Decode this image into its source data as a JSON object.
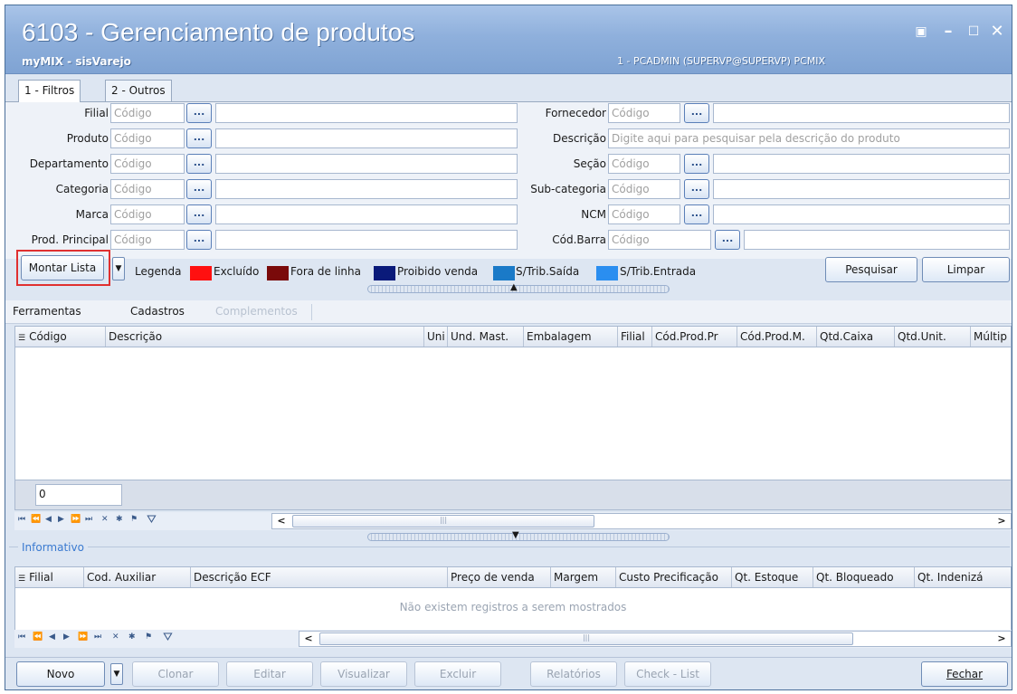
{
  "window": {
    "title": "6103 - Gerenciamento de produtos",
    "subtitle": "myMIX - sisVarejo",
    "user": "1 - PCADMIN (SUPERVP@SUPERVP)   PCMIX",
    "controls": {
      "restore": "▣",
      "minimize": "–",
      "maximize": "☐",
      "close": "✕"
    }
  },
  "tabs": [
    {
      "label": "1 - Filtros"
    },
    {
      "label": "2 - Outros"
    }
  ],
  "filters": {
    "left": [
      {
        "label": "Filial",
        "placeholder": "Código"
      },
      {
        "label": "Produto",
        "placeholder": "Código"
      },
      {
        "label": "Departamento",
        "placeholder": "Código"
      },
      {
        "label": "Categoria",
        "placeholder": "Código"
      },
      {
        "label": "Marca",
        "placeholder": "Código"
      },
      {
        "label": "Prod. Principal",
        "placeholder": "Código"
      }
    ],
    "right": [
      {
        "label": "Fornecedor",
        "placeholder": "Código"
      },
      {
        "label": "Descrição",
        "placeholder": "Digite aqui para pesquisar pela descrição do produto"
      },
      {
        "label": "Seção",
        "placeholder": "Código"
      },
      {
        "label": "Sub-categoria",
        "placeholder": "Código"
      },
      {
        "label": "NCM",
        "placeholder": "Código"
      },
      {
        "label": "Cód.Barra",
        "placeholder": "Código"
      }
    ],
    "dots_label": "..."
  },
  "legend": {
    "title": "Legenda",
    "items": [
      {
        "label": "Excluído",
        "color": "#ff1010"
      },
      {
        "label": "Fora de linha",
        "color": "#7a0a0a"
      },
      {
        "label": "Proibido venda",
        "color": "#0a1a7a"
      },
      {
        "label": "S/Trib.Saída",
        "color": "#1a7ac8"
      },
      {
        "label": "S/Trib.Entrada",
        "color": "#2a8ef0"
      }
    ]
  },
  "actions": {
    "montar_lista": "Montar Lista",
    "pesquisar": "Pesquisar",
    "limpar": "Limpar",
    "dropdown_arrow": "▼"
  },
  "menu": {
    "items": [
      "Ferramentas",
      "Cadastros",
      "Complementos"
    ]
  },
  "main_grid": {
    "columns": [
      "Código",
      "Descrição",
      "Uni",
      "Und. Mast.",
      "Embalagem",
      "Filial",
      "Cód.Prod.Pr",
      "Cód.Prod.M.",
      "Qtd.Caixa",
      "Qtd.Unit.",
      "Múltip"
    ],
    "count": "0",
    "scroll_left": "<",
    "scroll_right": ">"
  },
  "informativo": {
    "title": "Informativo",
    "columns": [
      "Filial",
      "Cod. Auxiliar",
      "Descrição ECF",
      "Preço de venda",
      "Margem",
      "Custo Precificação",
      "Qt. Estoque",
      "Qt. Bloqueado",
      "Qt. Indenizá"
    ],
    "empty_message": "Não existem registros a serem mostrados"
  },
  "footer": {
    "novo": "Novo",
    "clonar": "Clonar",
    "editar": "Editar",
    "visualizar": "Visualizar",
    "excluir": "Excluir",
    "relatorios": "Relatórios",
    "checklist": "Check - List",
    "fechar": "Fechar"
  },
  "colors": {
    "highlight_box": "#e03030",
    "title_gradient_top": "#a9c4e8",
    "title_gradient_bottom": "#7fa3d3"
  }
}
